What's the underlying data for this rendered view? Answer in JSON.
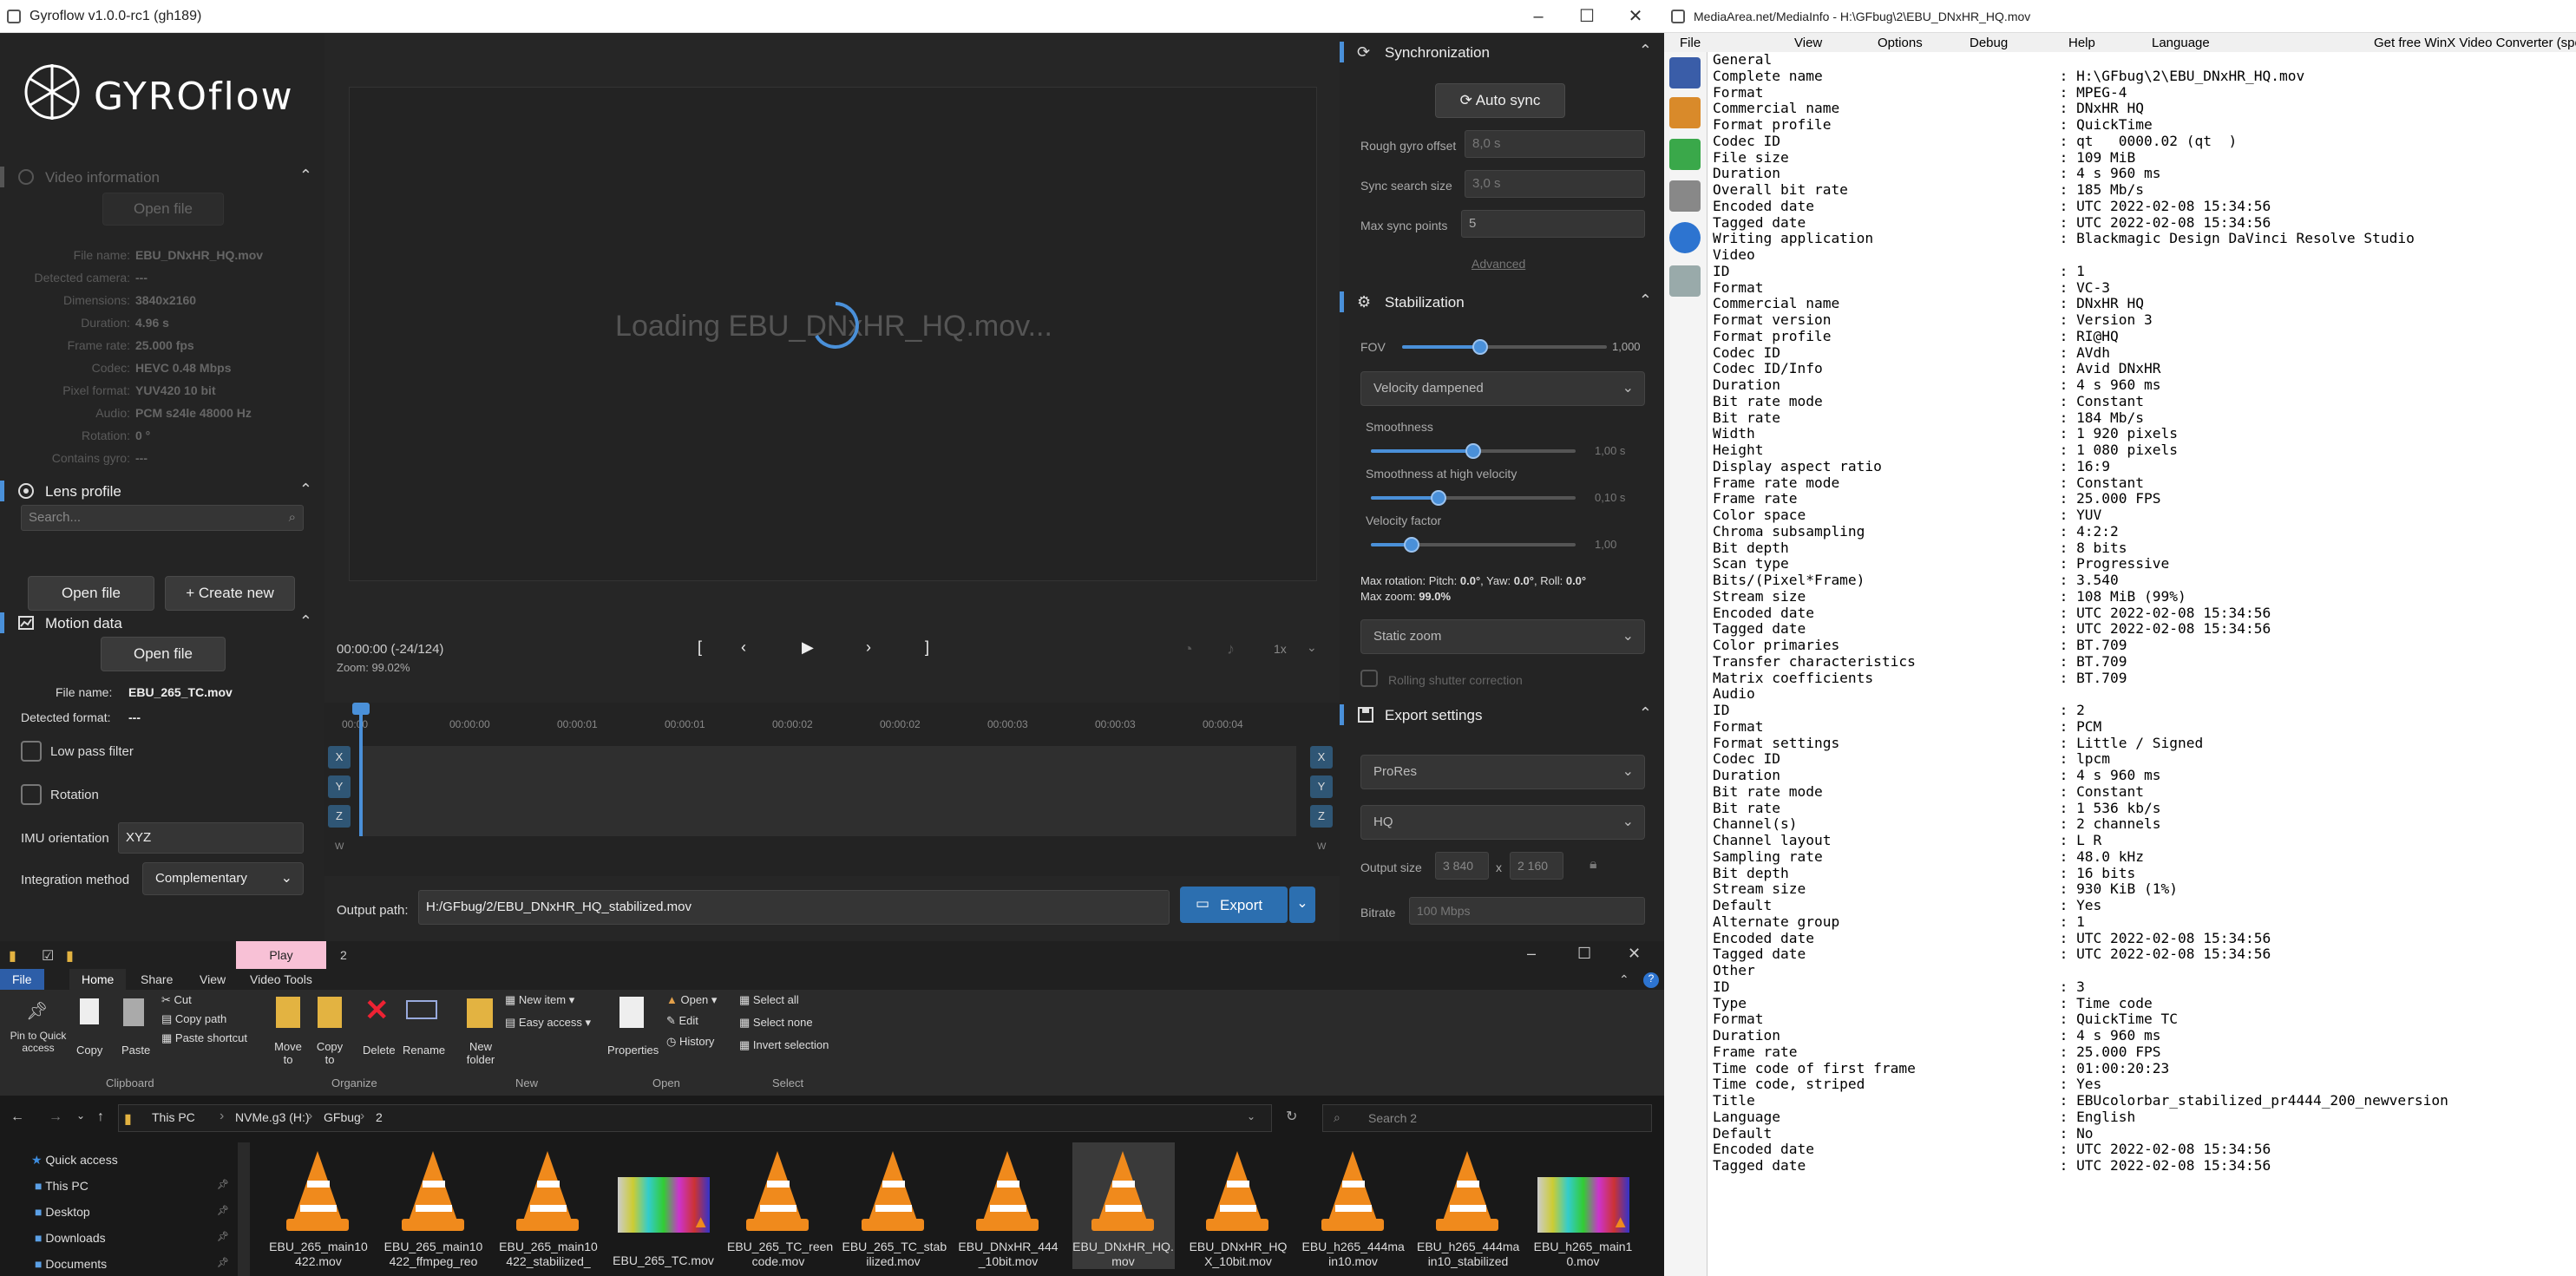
{
  "gyroflow": {
    "window_title": "Gyroflow v1.0.0-rc1 (gh189)",
    "logo_text": "GYROflow",
    "video_info": {
      "header": "Video information",
      "open_file": "Open file",
      "rows": [
        {
          "k": "File name:",
          "v": "EBU_DNxHR_HQ.mov"
        },
        {
          "k": "Detected camera:",
          "v": "---"
        },
        {
          "k": "Dimensions:",
          "v": "3840x2160"
        },
        {
          "k": "Duration:",
          "v": "4.96 s"
        },
        {
          "k": "Frame rate:",
          "v": "25.000 fps"
        },
        {
          "k": "Codec:",
          "v": "HEVC 0.48 Mbps"
        },
        {
          "k": "Pixel format:",
          "v": "YUV420 10 bit"
        },
        {
          "k": "Audio:",
          "v": "PCM s24le 48000 Hz"
        },
        {
          "k": "Rotation:",
          "v": "0 °"
        },
        {
          "k": "Contains gyro:",
          "v": "---"
        }
      ]
    },
    "lens_profile": {
      "header": "Lens profile",
      "search_placeholder": "Search...",
      "open_file": "Open file",
      "create_new": "Create new"
    },
    "motion_data": {
      "header": "Motion data",
      "open_file": "Open file",
      "file_name_label": "File name:",
      "file_name": "EBU_265_TC.mov",
      "detected_format_label": "Detected format:",
      "detected_format": "---",
      "low_pass": "Low pass filter",
      "rotation": "Rotation",
      "imu_label": "IMU orientation",
      "imu_value": "XYZ",
      "integration_label": "Integration method",
      "integration_value": "Complementary"
    },
    "preview": {
      "loading_text": "Loading EBU_DNxHR_HQ.mov...",
      "timecode": "00:00:00 (-24/124)",
      "zoom": "Zoom: 99.02%",
      "speed": "1x"
    },
    "timeline": {
      "ticks": [
        "00:00",
        "00:00:00",
        "00:00:01",
        "00:00:01",
        "00:00:02",
        "00:00:02",
        "00:00:03",
        "00:00:03",
        "00:00:04"
      ],
      "axes_left": [
        "X",
        "Y",
        "Z"
      ],
      "axes_right": [
        "X",
        "Y",
        "Z"
      ],
      "w": "W"
    },
    "output": {
      "label": "Output path:",
      "path": "H:/GFbug/2/EBU_DNxHR_HQ_stabilized.mov",
      "export": "Export"
    },
    "sync": {
      "header": "Synchronization",
      "auto_sync": "Auto sync",
      "rough_offset_label": "Rough gyro offset",
      "rough_offset": "8,0 s",
      "search_size_label": "Sync search size",
      "search_size": "3,0 s",
      "max_points_label": "Max sync points",
      "max_points": "5",
      "advanced": "Advanced"
    },
    "stabilization": {
      "header": "Stabilization",
      "fov_label": "FOV",
      "fov": "1,000",
      "fov_level": 0.38,
      "method": "Velocity dampened",
      "smoothness_label": "Smoothness",
      "smoothness": "1,00 s",
      "smoothness_level": 0.5,
      "smooth_hv_label": "Smoothness at high velocity",
      "smooth_hv": "0,10 s",
      "smooth_hv_level": 0.33,
      "vel_factor_label": "Velocity factor",
      "vel_factor": "1,00",
      "vel_factor_level": 0.2,
      "max_rotation_prefix": "Max rotation: Pitch: ",
      "pitch": "0.0°",
      "yaw_prefix": ", Yaw: ",
      "yaw": "0.0°",
      "roll_prefix": ", Roll: ",
      "roll": "0.0°",
      "max_zoom_prefix": "Max zoom: ",
      "max_zoom": "99.0%",
      "zoom_mode": "Static zoom",
      "rolling_shutter": "Rolling shutter correction"
    },
    "export_settings": {
      "header": "Export settings",
      "codec": "ProRes",
      "profile": "HQ",
      "output_size_label": "Output size",
      "width": "3 840",
      "x": "x",
      "height": "2 160",
      "bitrate_label": "Bitrate",
      "bitrate": "100 Mbps"
    }
  },
  "mediainfo": {
    "window_title": "MediaArea.net/MediaInfo - H:\\GFbug\\2\\EBU_DNxHR_HQ.mov",
    "menu": [
      "File",
      "View",
      "Options",
      "Debug",
      "Help",
      "Language",
      "Get free WinX Video Converter (sponsored)"
    ],
    "lines": [
      "General",
      "Complete name                            : H:\\GFbug\\2\\EBU_DNxHR_HQ.mov",
      "Format                                   : MPEG-4",
      "Commercial name                          : DNxHR HQ",
      "Format profile                           : QuickTime",
      "Codec ID                                 : qt   0000.02 (qt  )",
      "File size                                : 109 MiB",
      "Duration                                 : 4 s 960 ms",
      "Overall bit rate                         : 185 Mb/s",
      "Encoded date                             : UTC 2022-02-08 15:34:56",
      "Tagged date                              : UTC 2022-02-08 15:34:56",
      "Writing application                      : Blackmagic Design DaVinci Resolve Studio",
      "",
      "Video",
      "ID                                       : 1",
      "Format                                   : VC-3",
      "Commercial name                          : DNxHR HQ",
      "Format version                           : Version 3",
      "Format profile                           : RI@HQ",
      "Codec ID                                 : AVdh",
      "Codec ID/Info                            : Avid DNxHR",
      "Duration                                 : 4 s 960 ms",
      "Bit rate mode                            : Constant",
      "Bit rate                                 : 184 Mb/s",
      "Width                                    : 1 920 pixels",
      "Height                                   : 1 080 pixels",
      "Display aspect ratio                     : 16:9",
      "Frame rate mode                          : Constant",
      "Frame rate                               : 25.000 FPS",
      "Color space                              : YUV",
      "Chroma subsampling                       : 4:2:2",
      "Bit depth                                : 8 bits",
      "Scan type                                : Progressive",
      "Bits/(Pixel*Frame)                       : 3.540",
      "Stream size                              : 108 MiB (99%)",
      "Encoded date                             : UTC 2022-02-08 15:34:56",
      "Tagged date                              : UTC 2022-02-08 15:34:56",
      "Color primaries                          : BT.709",
      "Transfer characteristics                 : BT.709",
      "Matrix coefficients                      : BT.709",
      "",
      "Audio",
      "ID                                       : 2",
      "Format                                   : PCM",
      "Format settings                          : Little / Signed",
      "Codec ID                                 : lpcm",
      "Duration                                 : 4 s 960 ms",
      "Bit rate mode                            : Constant",
      "Bit rate                                 : 1 536 kb/s",
      "Channel(s)                               : 2 channels",
      "Channel layout                           : L R",
      "Sampling rate                            : 48.0 kHz",
      "Bit depth                                : 16 bits",
      "Stream size                              : 930 KiB (1%)",
      "Default                                  : Yes",
      "Alternate group                          : 1",
      "Encoded date                             : UTC 2022-02-08 15:34:56",
      "Tagged date                              : UTC 2022-02-08 15:34:56",
      "",
      "Other",
      "ID                                       : 3",
      "Type                                     : Time code",
      "Format                                   : QuickTime TC",
      "Duration                                 : 4 s 960 ms",
      "Frame rate                               : 25.000 FPS",
      "Time code of first frame                 : 01:00:20:23",
      "Time code, striped                       : Yes",
      "Title                                    : EBUcolorbar_stabilized_pr4444_200_newversion",
      "Language                                 : English",
      "Default                                  : No",
      "Encoded date                             : UTC 2022-02-08 15:34:56",
      "Tagged date                              : UTC 2022-02-08 15:34:56"
    ]
  },
  "explorer": {
    "tab_play": "Play",
    "title_num": "2",
    "tabs": [
      "File",
      "Home",
      "Share",
      "View",
      "Video Tools"
    ],
    "clipboard": {
      "pin": "Pin to Quick access",
      "copy": "Copy",
      "paste": "Paste",
      "cut": "Cut",
      "copy_path": "Copy path",
      "paste_shortcut": "Paste shortcut",
      "group": "Clipboard"
    },
    "organize": {
      "move": "Move to",
      "copy": "Copy to",
      "delete": "Delete",
      "rename": "Rename",
      "group": "Organize"
    },
    "new_group": {
      "new_folder": "New folder",
      "new_item": "New item",
      "easy_access": "Easy access",
      "group": "New"
    },
    "open_group": {
      "properties": "Properties",
      "open": "Open",
      "edit": "Edit",
      "history": "History",
      "group": "Open"
    },
    "select_group": {
      "select_all": "Select all",
      "select_none": "Select none",
      "invert": "Invert selection",
      "group": "Select"
    },
    "breadcrumb": [
      "This PC",
      "NVMe.g3 (H:)",
      "GFbug",
      "2"
    ],
    "search_placeholder": "Search 2",
    "nav": [
      "Quick access",
      "This PC",
      "Desktop",
      "Downloads",
      "Documents"
    ],
    "files": [
      {
        "l1": "EBU_265_main10",
        "l2": "422.mov"
      },
      {
        "l1": "EBU_265_main10",
        "l2": "422_ffmpeg_reo"
      },
      {
        "l1": "EBU_265_main10",
        "l2": "422_stabilized_"
      },
      {
        "l1": "EBU_265_TC.mov",
        "l2": ""
      },
      {
        "l1": "EBU_265_TC_reen",
        "l2": "code.mov"
      },
      {
        "l1": "EBU_265_TC_stab",
        "l2": "ilized.mov"
      },
      {
        "l1": "EBU_DNxHR_444",
        "l2": "_10bit.mov"
      },
      {
        "l1": "EBU_DNxHR_HQ.",
        "l2": "mov"
      },
      {
        "l1": "EBU_DNxHR_HQ",
        "l2": "X_10bit.mov"
      },
      {
        "l1": "EBU_h265_444ma",
        "l2": "in10.mov"
      },
      {
        "l1": "EBU_h265_444ma",
        "l2": "in10_stabilized"
      },
      {
        "l1": "EBU_h265_main1",
        "l2": "0.mov"
      }
    ]
  }
}
